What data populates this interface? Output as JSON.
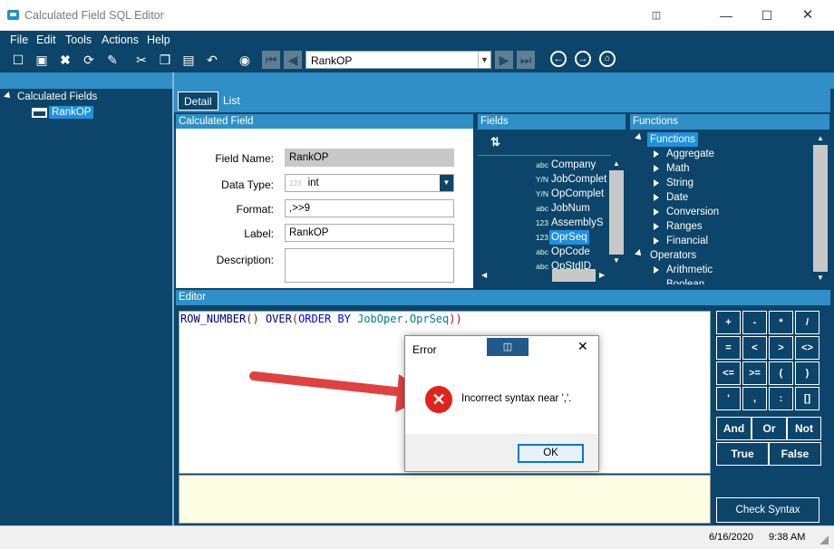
{
  "window": {
    "title": "Calculated Field SQL Editor"
  },
  "menu": [
    "File",
    "Edit",
    "Tools",
    "Actions",
    "Help"
  ],
  "toolbar": {
    "combo_value": "RankOP"
  },
  "tree": {
    "root": "Calculated Fields",
    "child": "RankOP"
  },
  "tabs": [
    "Detail",
    "List"
  ],
  "sections": {
    "calculated_field": "Calculated Field",
    "fields": "Fields",
    "functions": "Functions",
    "editor": "Editor"
  },
  "form": {
    "field_name_label": "Field Name:",
    "field_name_value": "RankOP",
    "data_type_label": "Data Type:",
    "data_type_icon_text": "123",
    "data_type_value": "int",
    "format_label": "Format:",
    "format_value": ",>>9",
    "label_label": "Label:",
    "label_value": "RankOP",
    "description_label": "Description:",
    "description_value": ""
  },
  "fields": [
    {
      "type": "abc",
      "name": "Company"
    },
    {
      "type": "Y/N",
      "name": "JobComplet"
    },
    {
      "type": "Y/N",
      "name": "OpComplet"
    },
    {
      "type": "abc",
      "name": "JobNum"
    },
    {
      "type": "123",
      "name": "AssemblyS"
    },
    {
      "type": "123",
      "name": "OprSeq"
    },
    {
      "type": "abc",
      "name": "OpCode"
    },
    {
      "type": "abc",
      "name": "OpStdID"
    }
  ],
  "functions": {
    "root": "Functions",
    "items": [
      "Aggregate",
      "Math",
      "String",
      "Date",
      "Conversion",
      "Ranges",
      "Financial"
    ],
    "operators": "Operators",
    "operator_items": [
      "Arithmetic",
      "Boolean"
    ]
  },
  "editor": {
    "code": [
      "ROW_NUMBER",
      "()",
      " ",
      "OVER",
      "(",
      "ORDER BY",
      " ",
      "JobOper.OprSeq",
      "))"
    ]
  },
  "calc_buttons": [
    "+",
    "-",
    "*",
    "/",
    "=",
    "<",
    ">",
    "<>",
    "<=",
    ">=",
    "(",
    ")",
    "'",
    ",",
    ":",
    "[]"
  ],
  "logic_buttons": [
    "And",
    "Or",
    "Not"
  ],
  "bool_buttons": [
    "True",
    "False"
  ],
  "check_syntax_label": "Check Syntax",
  "status": {
    "date": "6/16/2020",
    "time": "9:38 AM"
  },
  "dialog": {
    "title": "Error",
    "message": "Incorrect syntax near ','.",
    "ok_label": "OK"
  },
  "colors": {
    "navy": "#0c4569",
    "accent_blue": "#2f8fc6",
    "selection": "#1e90e0",
    "arrow_red": "#e04040",
    "error_red": "#e0241c"
  }
}
